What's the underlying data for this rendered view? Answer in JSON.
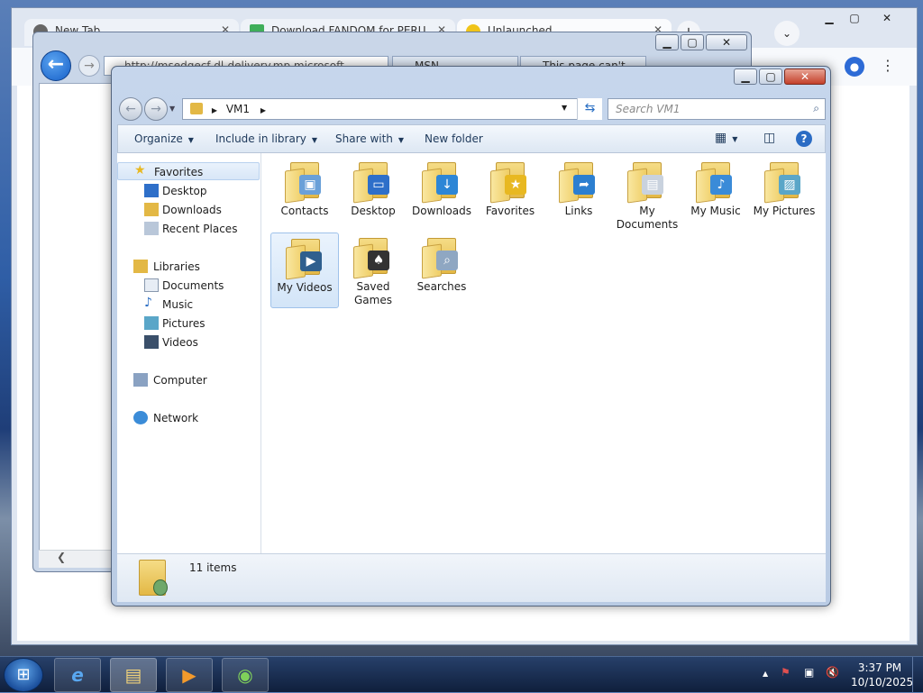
{
  "chrome": {
    "tabs": [
      {
        "title": "New Tab"
      },
      {
        "title": "Download FANDOM for PERU"
      },
      {
        "title": "Unlaunched"
      }
    ],
    "newtab_label": "+",
    "tabsearch_label": "⌄",
    "controls": {
      "min": "▁",
      "max": "▢",
      "close": "✕"
    }
  },
  "ie": {
    "address": "http://msedgecf-dl-delivery.mp.microsoft",
    "tabs": [
      {
        "title": "MSN"
      },
      {
        "title": "This page can't..."
      }
    ],
    "controls": {
      "min": "▁",
      "max": "▢",
      "close": "✕"
    },
    "back_glyph": "←",
    "forward_glyph": "→"
  },
  "explorer": {
    "controls": {
      "min": "▁",
      "max": "▢",
      "close": "✕"
    },
    "breadcrumb": [
      "VM1"
    ],
    "search_placeholder": "Search VM1",
    "commands": {
      "organize": "Organize",
      "include": "Include in library",
      "share": "Share with",
      "new_folder": "New folder"
    },
    "nav": {
      "favorites": {
        "label": "Favorites",
        "items": [
          "Desktop",
          "Downloads",
          "Recent Places"
        ]
      },
      "libraries": {
        "label": "Libraries",
        "items": [
          "Documents",
          "Music",
          "Pictures",
          "Videos"
        ]
      },
      "computer": "Computer",
      "network": "Network"
    },
    "items": [
      {
        "name": "Contacts",
        "icon": "contacts-icon",
        "overlay": "▣",
        "color": "#6aa0d8"
      },
      {
        "name": "Desktop",
        "icon": "desktop-icon",
        "overlay": "▭",
        "color": "#2e6fc9"
      },
      {
        "name": "Downloads",
        "icon": "downloads-icon",
        "overlay": "↓",
        "color": "#2d86d6"
      },
      {
        "name": "Favorites",
        "icon": "favorites-icon",
        "overlay": "★",
        "color": "#e8b821"
      },
      {
        "name": "Links",
        "icon": "links-icon",
        "overlay": "➦",
        "color": "#2c7fd0"
      },
      {
        "name": "My Documents",
        "icon": "my-documents-icon",
        "overlay": "▤",
        "color": "#c9d2de"
      },
      {
        "name": "My Music",
        "icon": "my-music-icon",
        "overlay": "♪",
        "color": "#3a8bd8"
      },
      {
        "name": "My Pictures",
        "icon": "my-pictures-icon",
        "overlay": "▨",
        "color": "#5aa6c8"
      },
      {
        "name": "My Videos",
        "icon": "my-videos-icon",
        "overlay": "▶",
        "color": "#2f5f8e"
      },
      {
        "name": "Saved Games",
        "icon": "saved-games-icon",
        "overlay": "♠",
        "color": "#333333"
      },
      {
        "name": "Searches",
        "icon": "searches-icon",
        "overlay": "⌕",
        "color": "#8fa7c2"
      }
    ],
    "selected_item": "My Videos",
    "status": "11 items"
  },
  "taskbar": {
    "start_glyph": "⊞",
    "apps": [
      {
        "name": "internet-explorer",
        "glyph": "e"
      },
      {
        "name": "windows-explorer",
        "glyph": "▤"
      },
      {
        "name": "media-player",
        "glyph": "▶"
      },
      {
        "name": "chrome",
        "glyph": "◉"
      }
    ],
    "tray_arrow": "▲",
    "time": "3:37 PM",
    "date": "10/10/2025"
  }
}
